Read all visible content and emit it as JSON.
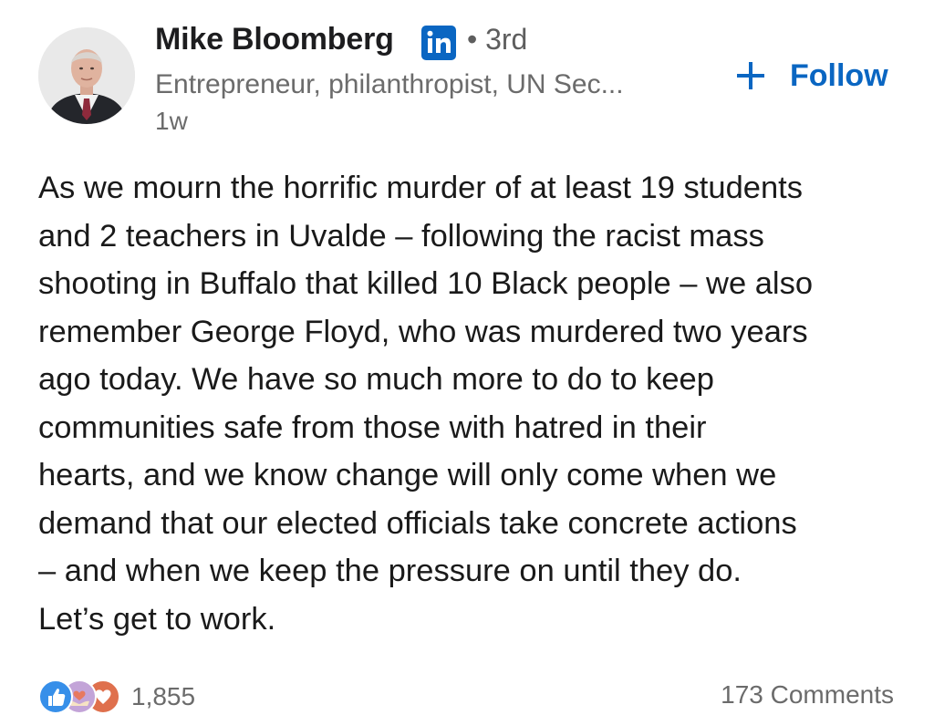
{
  "post": {
    "author": {
      "name": "Mike Bloomberg",
      "badge_icon": "linkedin-icon",
      "degree": "• 3rd",
      "headline": "Entrepreneur, philanthropist, UN Sec...",
      "timestamp": "1w"
    },
    "follow": {
      "icon": "plus-icon",
      "label": "Follow"
    },
    "body_lines": [
      "As we mourn the horrific murder of at least 19 students",
      "and 2 teachers in Uvalde – following the racist mass",
      "shooting in Buffalo that killed 10 Black people – we also",
      "remember George Floyd, who was murdered two years",
      "ago today. We have so much more to do to keep",
      "communities safe from those with hatred in their",
      "hearts, and we know change will only come when we",
      "demand that our elected officials take concrete actions",
      "– and when we keep the pressure on until they do.",
      "Let’s get to work."
    ],
    "social": {
      "reaction_icons": [
        "like-icon",
        "support-icon",
        "love-icon"
      ],
      "reaction_count": "1,855",
      "comments": "173 Comments"
    }
  },
  "colors": {
    "linkedin_blue": "#0a66c2",
    "text_primary": "#1d1d1f",
    "text_secondary": "#6b6b6b",
    "love_red": "#df704d",
    "support_purple": "#c3a4d8"
  }
}
